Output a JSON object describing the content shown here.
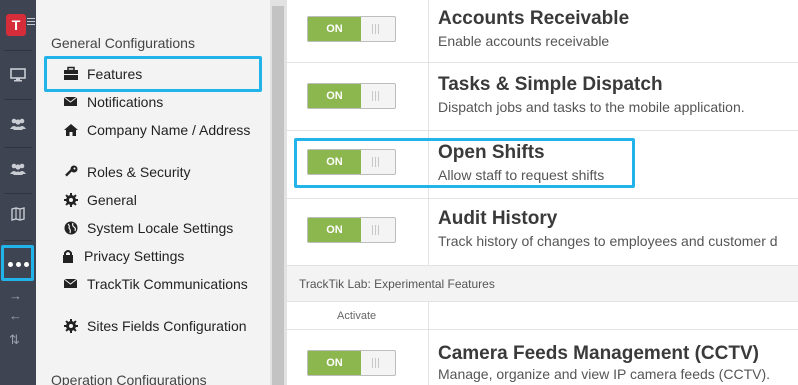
{
  "rail": {
    "logo_letter": "T",
    "items": [
      {
        "name": "monitor",
        "icon": "monitor-icon"
      },
      {
        "name": "users",
        "icon": "users-icon"
      },
      {
        "name": "people",
        "icon": "people-icon"
      },
      {
        "name": "map",
        "icon": "map-icon"
      },
      {
        "name": "more",
        "icon": "more-icon"
      }
    ],
    "arrows": [
      "→",
      "←",
      "⇅"
    ],
    "accent": "#21b3ea"
  },
  "nav": {
    "heading": "General Configurations",
    "items": [
      {
        "label": "Features",
        "icon": "briefcase-icon"
      },
      {
        "label": "Notifications",
        "icon": "envelope-icon"
      },
      {
        "label": "Company Name / Address",
        "icon": "home-icon"
      },
      {
        "label": "Roles & Security",
        "icon": "key-icon"
      },
      {
        "label": "General",
        "icon": "gear-icon"
      },
      {
        "label": "System Locale Settings",
        "icon": "globe-icon"
      },
      {
        "label": "Privacy Settings",
        "icon": "lock-icon"
      },
      {
        "label": "TrackTik Communications",
        "icon": "envelope-icon"
      },
      {
        "label": "Sites Fields Configuration",
        "icon": "gear-icon"
      }
    ],
    "heading2": "Operation Configurations"
  },
  "features": [
    {
      "title": "Accounts Receivable",
      "desc": "Enable accounts receivable",
      "toggle": "ON"
    },
    {
      "title": "Tasks & Simple Dispatch",
      "desc": "Dispatch jobs and tasks to the mobile application.",
      "toggle": "ON"
    },
    {
      "title": "Open Shifts",
      "desc": "Allow staff to request shifts",
      "toggle": "ON"
    },
    {
      "title": "Audit History",
      "desc": "Track history of changes to employees and customer d",
      "toggle": "ON"
    }
  ],
  "lab": {
    "heading": "TrackTik Lab: Experimental Features",
    "column": "Activate",
    "features": [
      {
        "title": "Camera Feeds Management (CCTV)",
        "desc": "Manage, organize and view IP camera feeds (CCTV).",
        "toggle": "ON"
      }
    ]
  },
  "colors": {
    "toggle_on": "#8cb64e",
    "rail_bg": "#3e4452",
    "brand": "#d62d3a"
  }
}
